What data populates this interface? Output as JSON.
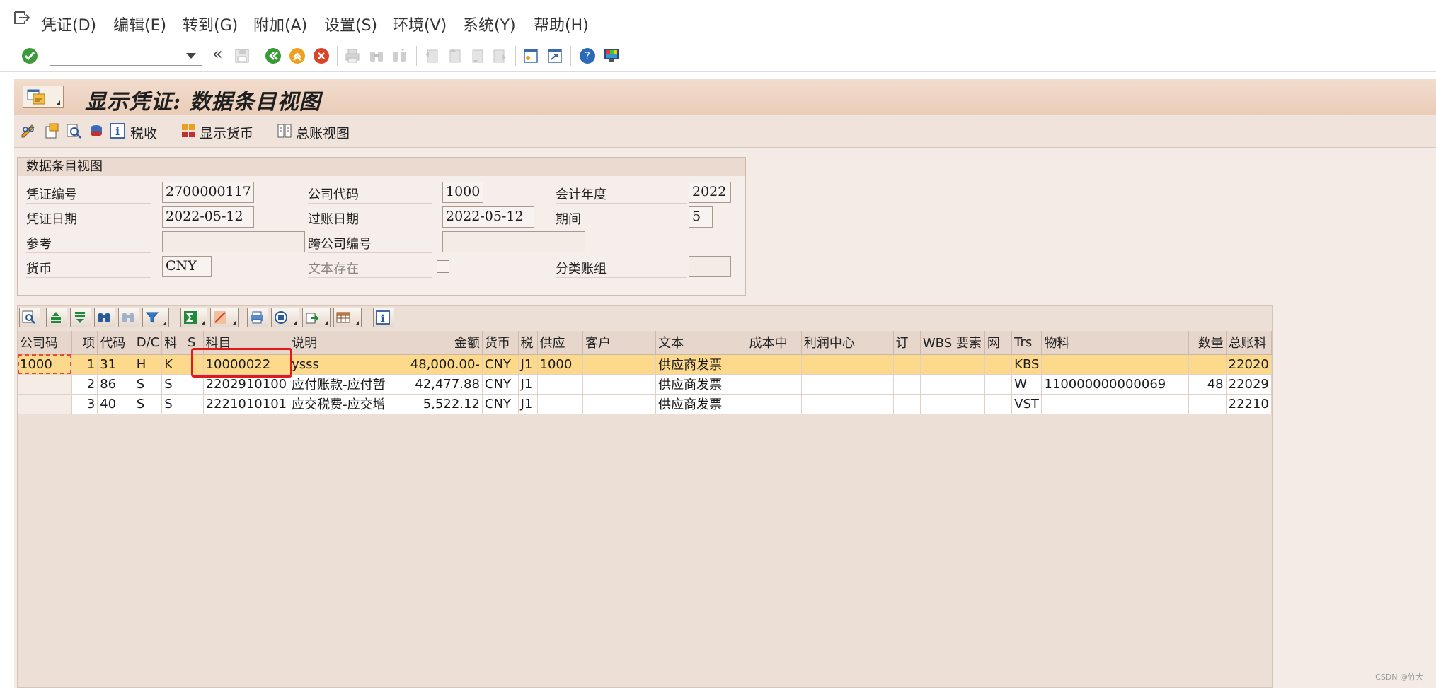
{
  "menu": {
    "items": [
      "凭证(D)",
      "编辑(E)",
      "转到(G)",
      "附加(A)",
      "设置(S)",
      "环境(V)",
      "系统(Y)",
      "帮助(H)"
    ]
  },
  "toolbar": {
    "command_value": "",
    "icons": [
      "enter-icon",
      "back-arrows-icon",
      "save-icon",
      "back-icon",
      "exit-icon",
      "cancel-icon",
      "print-icon",
      "find-icon",
      "find-next-icon",
      "first-page-icon",
      "prev-page-icon",
      "next-page-icon",
      "last-page-icon",
      "new-session-icon",
      "shortcut-icon",
      "help-icon",
      "customize-layout-icon"
    ]
  },
  "page": {
    "title": "显示凭证: 数据条目视图"
  },
  "app_toolbar": {
    "tax_label": "税收",
    "currency_label": "显示货币",
    "gl_view_label": "总账视图"
  },
  "header": {
    "box_title": "数据条目视图",
    "doc_number_label": "凭证编号",
    "doc_number": "2700000117",
    "company_code_label": "公司代码",
    "company_code": "1000",
    "fiscal_year_label": "会计年度",
    "fiscal_year": "2022",
    "doc_date_label": "凭证日期",
    "doc_date": "2022-05-12",
    "posting_date_label": "过账日期",
    "posting_date": "2022-05-12",
    "period_label": "期间",
    "period": "5",
    "reference_label": "参考",
    "reference": "",
    "cross_cc_label": "跨公司编号",
    "cross_cc": "",
    "currency_label": "货币",
    "currency": "CNY",
    "text_exists_label": "文本存在",
    "ledger_group_label": "分类账组",
    "ledger_group": ""
  },
  "grid": {
    "columns": [
      "公司码",
      "项",
      "代码",
      "D/C",
      "科",
      "S",
      "科目",
      "说明",
      "金额",
      "货币",
      "税",
      "供应",
      "客户",
      "文本",
      "成本中",
      "利润中心",
      "订",
      "WBS 要素",
      "网",
      "Trs",
      "物料",
      "数量",
      "总账科"
    ],
    "rows": [
      {
        "cc": "1000",
        "item": "1",
        "code": "31",
        "dc": "H",
        "type": "K",
        "s": "",
        "account": "10000022",
        "desc": "ysss",
        "amount": "48,000.00-",
        "cur": "CNY",
        "tax": "J1",
        "vendor": "1000",
        "customer": "",
        "text": "供应商发票",
        "cost": "",
        "profit": "",
        "order": "",
        "wbs": "",
        "net": "",
        "trs": "KBS",
        "material": "",
        "qty": "",
        "gl": "22020"
      },
      {
        "cc": "",
        "item": "2",
        "code": "86",
        "dc": "S",
        "type": "S",
        "s": "",
        "account": "2202910100",
        "desc": "应付账款-应付暂",
        "amount": "42,477.88",
        "cur": "CNY",
        "tax": "J1",
        "vendor": "",
        "customer": "",
        "text": "供应商发票",
        "cost": "",
        "profit": "",
        "order": "",
        "wbs": "",
        "net": "",
        "trs": "W",
        "material": "110000000000069",
        "qty": "48",
        "gl": "22029"
      },
      {
        "cc": "",
        "item": "3",
        "code": "40",
        "dc": "S",
        "type": "S",
        "s": "",
        "account": "2221010101",
        "desc": "应交税费-应交增",
        "amount": "5,522.12",
        "cur": "CNY",
        "tax": "J1",
        "vendor": "",
        "customer": "",
        "text": "供应商发票",
        "cost": "",
        "profit": "",
        "order": "",
        "wbs": "",
        "net": "",
        "trs": "VST",
        "material": "",
        "qty": "",
        "gl": "22210"
      }
    ]
  },
  "colors": {
    "selected_row": "#fdd98b",
    "title_bar": "#e9cdb9",
    "highlight_box": "#e11919"
  },
  "watermark": "CSDN @竹大"
}
